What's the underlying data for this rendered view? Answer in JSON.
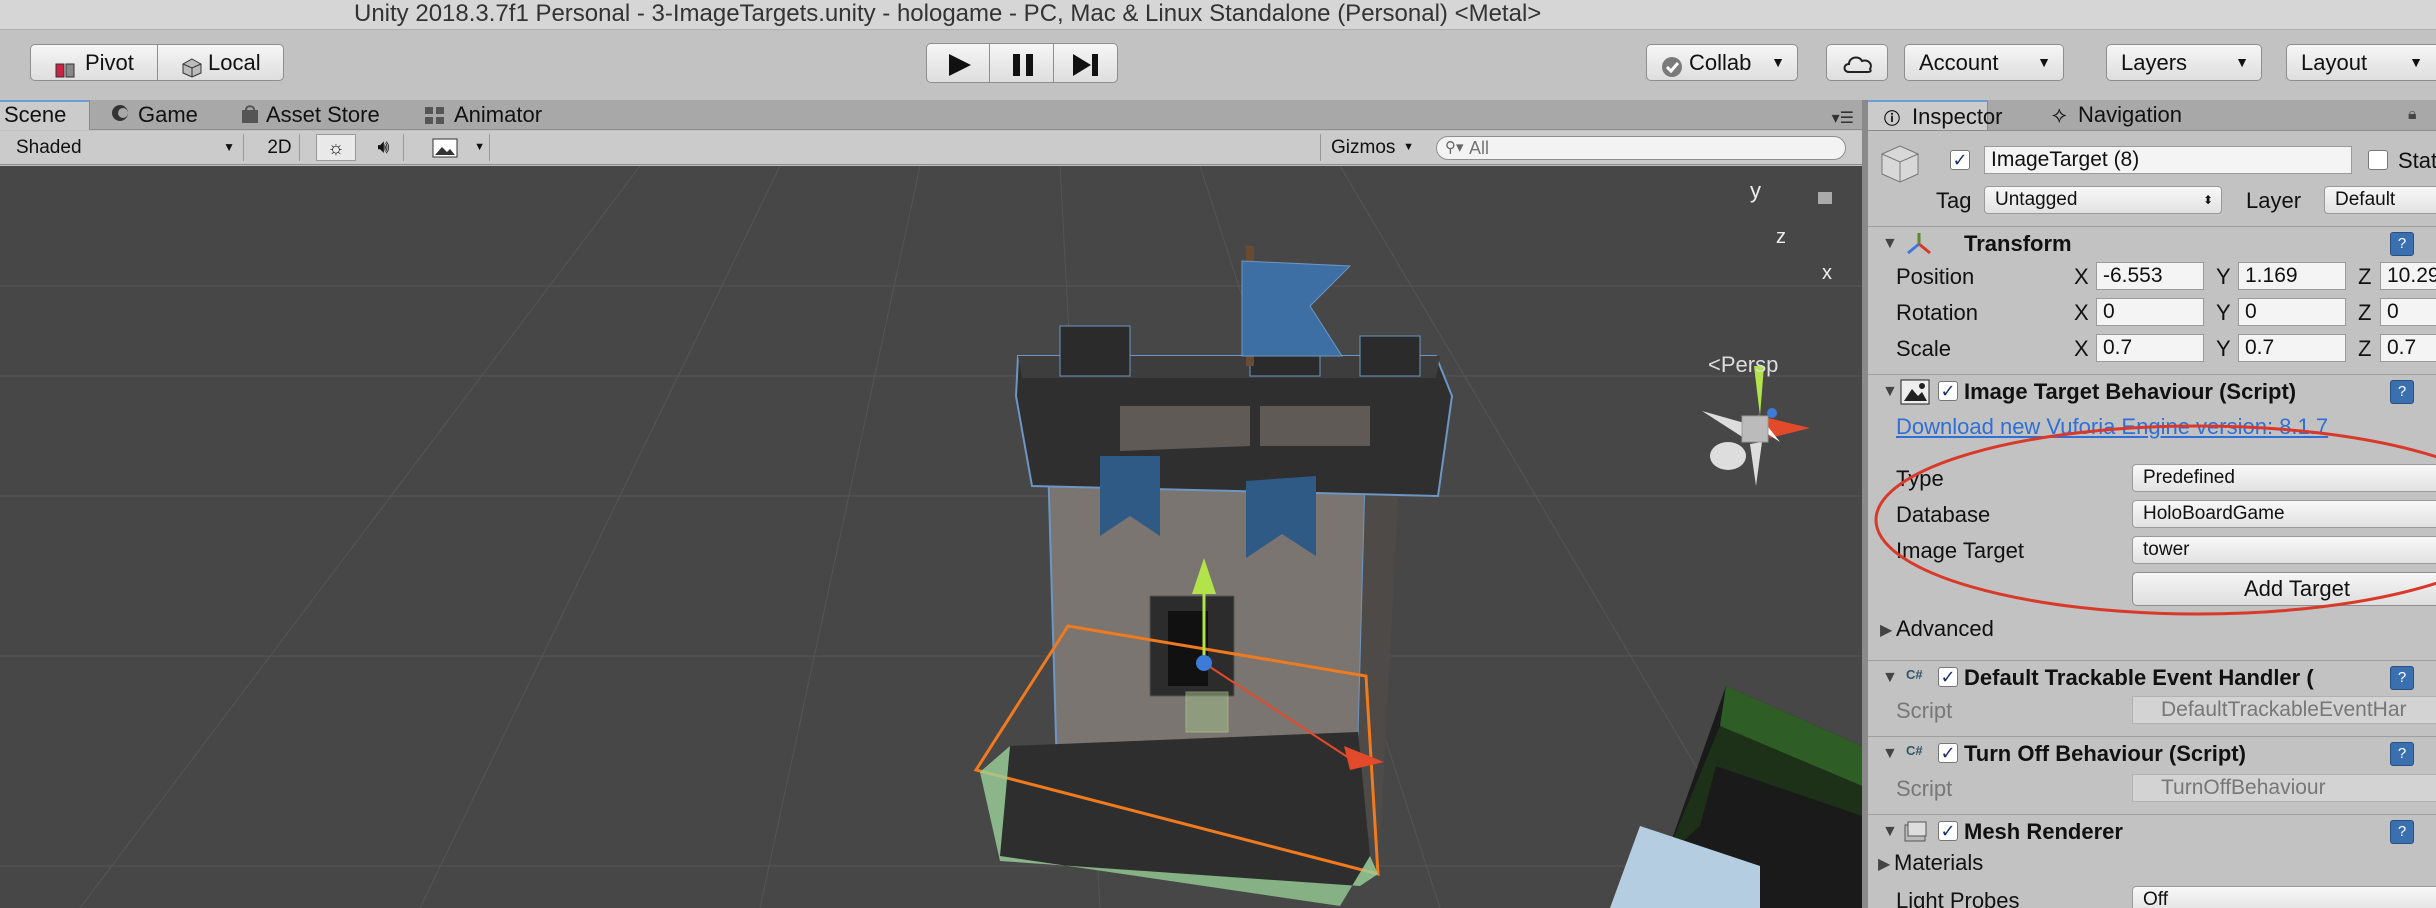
{
  "window": {
    "title": "Unity 2018.3.7f1 Personal - 3-ImageTargets.unity - hologame - PC, Mac & Linux Standalone (Personal) <Metal>"
  },
  "toolbar": {
    "pivot_label": "Pivot",
    "local_label": "Local",
    "collab_label": "Collab",
    "account_label": "Account",
    "layers_label": "Layers",
    "layout_label": "Layout"
  },
  "scene_tabs": [
    {
      "label": "Scene",
      "icon": "scene-icon",
      "active": true
    },
    {
      "label": "Game",
      "icon": "game-icon",
      "active": false
    },
    {
      "label": "Asset Store",
      "icon": "asset-store-icon",
      "active": false
    },
    {
      "label": "Animator",
      "icon": "animator-icon",
      "active": false
    }
  ],
  "scene_toolbar": {
    "shading_mode": "Shaded",
    "mode_2d": "2D",
    "gizmos_label": "Gizmos",
    "search_placeholder": "All"
  },
  "viewport": {
    "projection_label": "Persp",
    "gizmo_axes": {
      "y": "y",
      "z": "z",
      "x": "x"
    }
  },
  "inspector": {
    "tabs": [
      {
        "label": "Inspector",
        "icon": "info-icon",
        "active": true
      },
      {
        "label": "Navigation",
        "icon": "navigation-icon",
        "active": false
      }
    ],
    "object": {
      "name": "ImageTarget (8)",
      "static_label": "Stat",
      "tag_label": "Tag",
      "tag_value": "Untagged",
      "layer_label": "Layer",
      "layer_value": "Default"
    },
    "transform": {
      "title": "Transform",
      "rows": [
        {
          "label": "Position",
          "x": "-6.553",
          "y": "1.169",
          "z": "10.29"
        },
        {
          "label": "Rotation",
          "x": "0",
          "y": "0",
          "z": "0"
        },
        {
          "label": "Scale",
          "x": "0.7",
          "y": "0.7",
          "z": "0.7"
        }
      ]
    },
    "image_target": {
      "title": "Image Target Behaviour (Script)",
      "download_link": "Download new Vuforia Engine version: 8.1.7",
      "type_label": "Type",
      "type_value": "Predefined",
      "database_label": "Database",
      "database_value": "HoloBoardGame",
      "image_target_label": "Image Target",
      "image_target_value": "tower",
      "add_target_label": "Add Target",
      "advanced_label": "Advanced"
    },
    "default_handler": {
      "title": "Default Trackable Event Handler (",
      "script_label": "Script",
      "script_value": "DefaultTrackableEventHar"
    },
    "turn_off": {
      "title": "Turn Off Behaviour (Script)",
      "script_label": "Script",
      "script_value": "TurnOffBehaviour"
    },
    "mesh_renderer": {
      "title": "Mesh Renderer",
      "materials_label": "Materials",
      "light_probes_label": "Light Probes",
      "light_probes_value": "Off"
    }
  },
  "colors": {
    "highlight_circle": "#d9392b",
    "link_blue": "#2f6fd6",
    "selection_orange": "#f07a1e",
    "viewport_bg": "#474747"
  }
}
